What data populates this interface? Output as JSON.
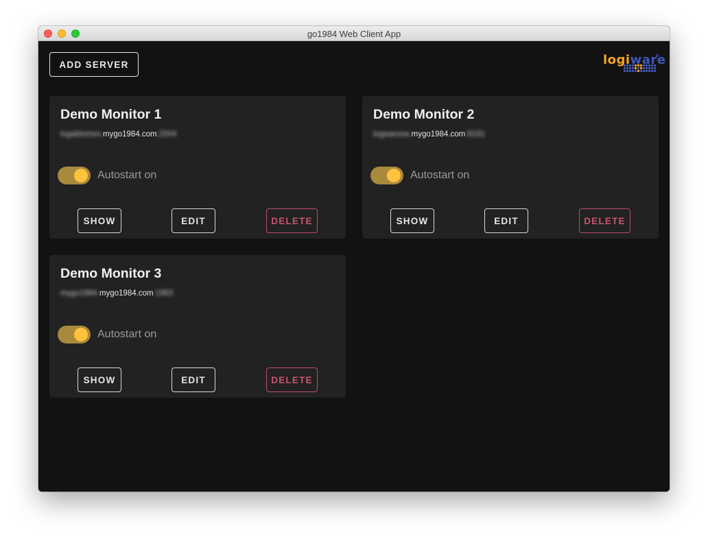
{
  "window": {
    "title": "go1984 Web Client App"
  },
  "toolbar": {
    "add_server_label": "ADD SERVER"
  },
  "logo": {
    "part1": "logi",
    "part2": "ware"
  },
  "servers": [
    {
      "name": "Demo Monitor 1",
      "host_prefix": "logaldomex.",
      "host_domain": "mygo1984.com",
      "host_port": ":2004",
      "autostart_label": "Autostart on",
      "autostart_on": true,
      "show_label": "SHOW",
      "edit_label": "EDIT",
      "delete_label": "DELETE"
    },
    {
      "name": "Demo Monitor 2",
      "host_prefix": "logwaresa.",
      "host_domain": "mygo1984.com",
      "host_port": ":8181",
      "autostart_label": "Autostart on",
      "autostart_on": true,
      "show_label": "SHOW",
      "edit_label": "EDIT",
      "delete_label": "DELETE"
    },
    {
      "name": "Demo Monitor 3",
      "host_prefix": "mygo1984.",
      "host_domain": "mygo1984.com",
      "host_port": ":1983",
      "autostart_label": "Autostart on",
      "autostart_on": true,
      "show_label": "SHOW",
      "edit_label": "EDIT",
      "delete_label": "DELETE"
    }
  ],
  "colors": {
    "background": "#121212",
    "card": "#222222",
    "toggle_track": "#a98a3d",
    "toggle_thumb": "#fec23d",
    "delete": "#c85570",
    "logo_orange": "#f5a623",
    "logo_blue": "#3f57b5"
  }
}
